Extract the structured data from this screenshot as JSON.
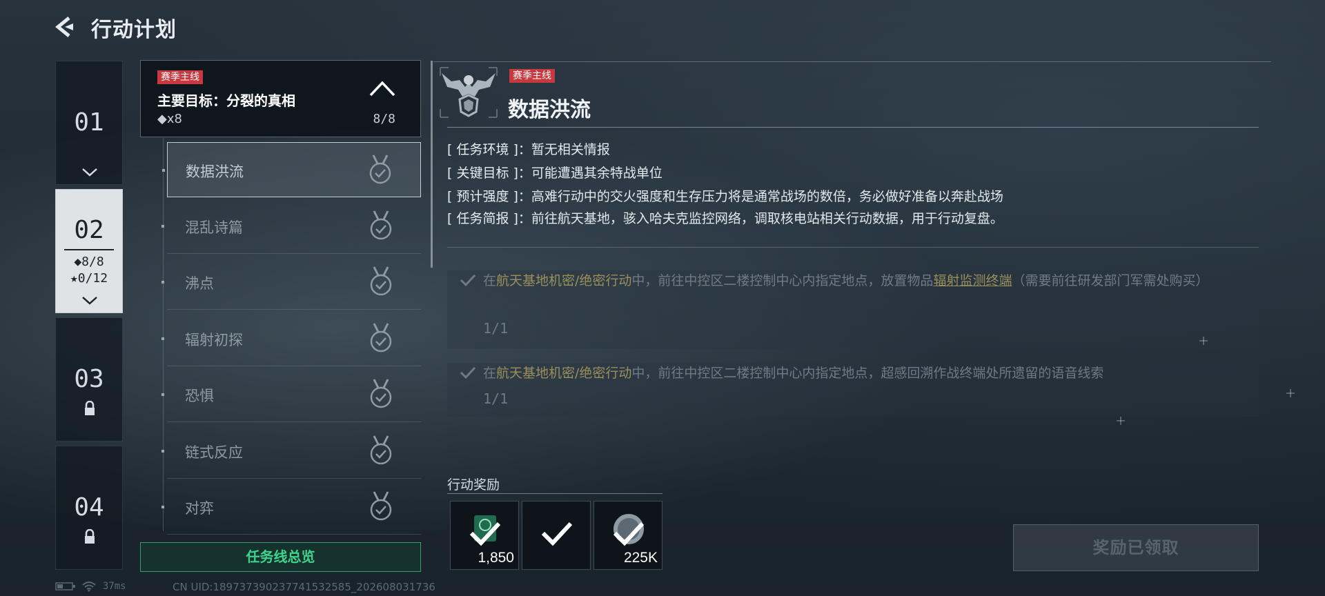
{
  "header": {
    "title": "行动计划"
  },
  "chapters": [
    {
      "num": "01"
    },
    {
      "num": "02",
      "diamond": "◆8/8",
      "star": "★0/12"
    },
    {
      "num": "03"
    },
    {
      "num": "04"
    }
  ],
  "mission_line": {
    "tag": "赛季主线",
    "title": "主要目标：分裂的真相",
    "count": "◆x8",
    "progress": "8/8",
    "missions": [
      "数据洪流",
      "混乱诗篇",
      "沸点",
      "辐射初探",
      "恐惧",
      "链式反应",
      "对弈"
    ],
    "overview_button": "任务线总览"
  },
  "detail": {
    "tag": "赛季主线",
    "title": "数据洪流",
    "info": [
      {
        "key": "[ 任务环境 ]",
        "value": "：暂无相关情报"
      },
      {
        "key": "[ 关键目标 ]",
        "value": "：可能遭遇其余特战单位"
      },
      {
        "key": "[ 预计强度 ]",
        "value": "：高难行动中的交火强度和生存压力将是通常战场的数倍，务必做好准备以奔赴战场"
      },
      {
        "key": "[ 任务简报 ]",
        "value": "：前往航天基地，骇入哈夫克监控网络，调取核电站相关行动数据，用于行动复盘。"
      }
    ],
    "objectives": [
      {
        "p1": "在",
        "h1": "航天基地机密/绝密行动",
        "p2": "中，前往中控区二楼控制中心内指定地点，放置物品",
        "h2": "辐射监测终端",
        "p3": "（需要前往研发部门军需处购买）",
        "progress": "1/1"
      },
      {
        "p1": "在",
        "h1": "航天基地机密/绝密行动",
        "p2": "中，前往中控区二楼控制中心内指定地点，超感回溯作战终端处所遗留的语音线索",
        "progress": "1/1"
      }
    ],
    "reward_title": "行动奖励",
    "rewards": [
      {
        "qty": "1,850",
        "icon": "currency-icon"
      },
      {
        "qty": "",
        "icon": "check-icon"
      },
      {
        "qty": "225K",
        "icon": "coin-icon"
      }
    ],
    "claim_button": "奖励已领取"
  },
  "status_bar": {
    "ping": "37ms",
    "uid": "CN UID:1897373902377415325​85_202608031736"
  },
  "colors": {
    "accent_green": "#3fd48b",
    "tag_red": "#c8383f",
    "highlight_gold": "#9b8f5a"
  }
}
